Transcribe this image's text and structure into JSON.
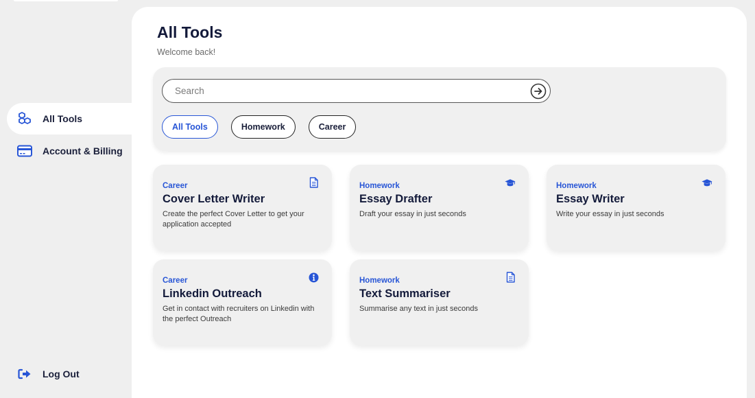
{
  "sidebar": {
    "items": [
      {
        "label": "All Tools",
        "icon": "cubes-icon",
        "active": true
      },
      {
        "label": "Account & Billing",
        "icon": "credit-card-icon",
        "active": false
      }
    ],
    "logout": {
      "label": "Log Out",
      "icon": "sign-out-icon"
    }
  },
  "header": {
    "title": "All Tools",
    "subtitle": "Welcome back!"
  },
  "search": {
    "placeholder": "Search",
    "value": ""
  },
  "filters": [
    {
      "label": "All Tools",
      "active": true
    },
    {
      "label": "Homework",
      "active": false
    },
    {
      "label": "Career",
      "active": false
    }
  ],
  "tools": [
    {
      "category": "Career",
      "title": "Cover Letter Writer",
      "description": "Create the perfect Cover Letter to get your application accepted",
      "icon": "document-icon"
    },
    {
      "category": "Homework",
      "title": "Essay Drafter",
      "description": "Draft your essay in just seconds",
      "icon": "graduation-cap-icon"
    },
    {
      "category": "Homework",
      "title": "Essay Writer",
      "description": "Write your essay in just seconds",
      "icon": "graduation-cap-icon"
    },
    {
      "category": "Career",
      "title": "Linkedin Outreach",
      "description": "Get in contact with recruiters on Linkedin with the perfect Outreach",
      "icon": "info-icon"
    },
    {
      "category": "Homework",
      "title": "Text Summariser",
      "description": "Summarise any text in just seconds",
      "icon": "document-icon"
    }
  ],
  "colors": {
    "accent": "#2755d6",
    "text_dark": "#131a3a",
    "background": "#efefef",
    "card": "#f0f0f0"
  }
}
